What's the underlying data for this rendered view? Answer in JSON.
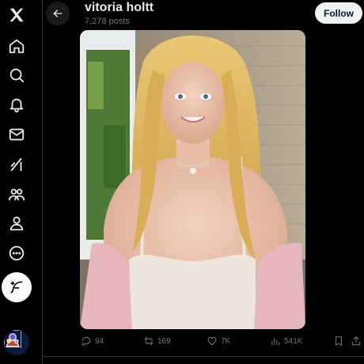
{
  "profile": {
    "name": "vitoria holtt",
    "posts_count": "7,278 posts",
    "follow_label": "Follow"
  },
  "nav": {
    "items": [
      {
        "icon": "x-logo-icon"
      },
      {
        "icon": "home-icon"
      },
      {
        "icon": "search-icon"
      },
      {
        "icon": "bell-icon"
      },
      {
        "icon": "mail-icon"
      },
      {
        "icon": "grok-icon"
      },
      {
        "icon": "communities-icon"
      },
      {
        "icon": "profile-icon"
      },
      {
        "icon": "more-icon"
      }
    ],
    "compose_icon": "compose-feather-icon",
    "avatar_icon": "account-avatar"
  },
  "post": {
    "media_description_icon": "photo",
    "replies": "94",
    "reposts": "169",
    "likes": "7K",
    "views": "541K"
  },
  "colors": {
    "background": "#000000",
    "text": "#e7e9ea",
    "muted": "#71767b",
    "border": "#2f3336",
    "follow_bg": "#eff3f4"
  }
}
